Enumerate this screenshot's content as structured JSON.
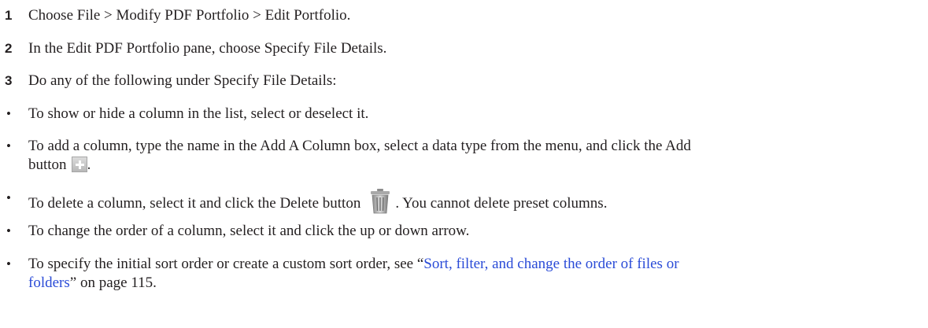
{
  "steps": [
    {
      "num": "1",
      "text": "Choose File > Modify PDF Portfolio > Edit Portfolio."
    },
    {
      "num": "2",
      "text": "In the Edit PDF Portfolio pane, choose Specify File Details."
    },
    {
      "num": "3",
      "text": "Do any of the following under Specify File Details:"
    }
  ],
  "bullet_symbol": "•",
  "bullets": {
    "show_hide": "To show or hide a column in the list, select or deselect it.",
    "add_before": "To add a column, type the name in the Add A Column box, select a data type from the menu, and click the Add",
    "add_line2": "button",
    "add_after": ".",
    "delete_before": "To delete a column, select it and click the Delete button",
    "delete_after": ". You cannot delete preset columns.",
    "order": "To change the order of a column, select it and click the up or down arrow.",
    "sort_before": "To specify the initial sort order or create a custom sort order, see “",
    "sort_link_line1": "Sort, filter, and change the order of files or",
    "sort_link_line2": "folders",
    "sort_after": "” on page 115."
  },
  "icons": {
    "add": "add-button-icon",
    "delete": "trash-icon"
  }
}
